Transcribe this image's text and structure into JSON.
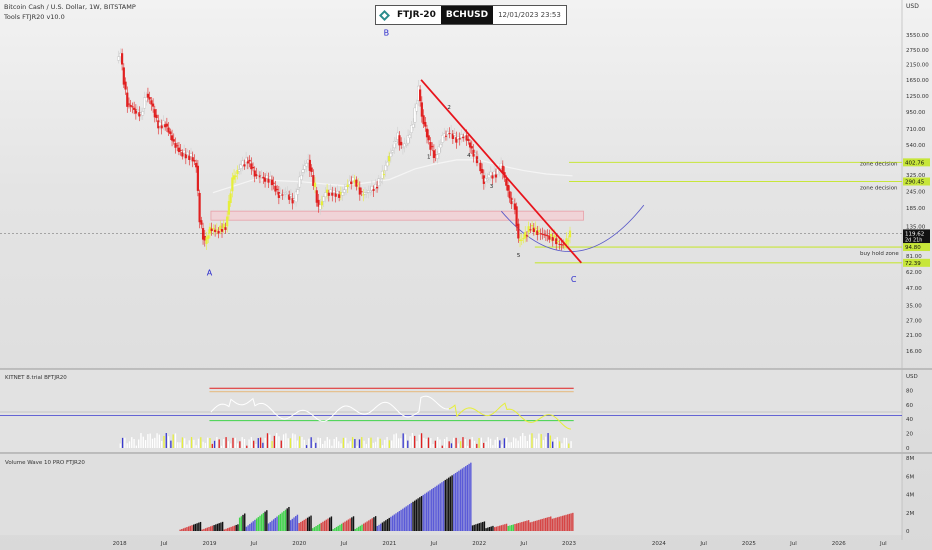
{
  "header": {
    "symbol_line": "Bitcoin Cash / U.S. Dollar, 1W, BITSTAMP",
    "tools_line": "Tools FTJR20 v10.0",
    "badge_left": "FTJR-20",
    "badge_symbol": "BCHUSD",
    "badge_date": "12/01/2023 23:53"
  },
  "panes": {
    "indicator_title": "KITNET  8.trial  BFTJR20",
    "volume_title": "Volume Wave 10 PRO FTJR20"
  },
  "colors": {
    "candle_up": "#ffffff",
    "candle_down": "#e02020",
    "candle_yellow": "#e6ef3a",
    "trendline": "#e8141c",
    "zone_line": "#c7e63a",
    "cup_curve": "#5a5ac8",
    "moving_average": "#f5f5f5",
    "volume_blue": "#5a5ad8",
    "volume_red": "#d64545",
    "volume_green": "#3fd34a",
    "volume_black": "#111111"
  },
  "chart_data": {
    "type": "candlestick",
    "x_ticks": [
      "2018",
      "Jul",
      "2019",
      "Jul",
      "2020",
      "Jul",
      "2021",
      "Jul",
      "2022",
      "Jul",
      "2023",
      "2024",
      "Jul",
      "2025",
      "Jul",
      "2026",
      "Jul"
    ],
    "y_axis_unit": "USD",
    "y_ticks": [
      "3550.00",
      "2750.00",
      "2150.00",
      "1650.00",
      "1250.00",
      "950.00",
      "710.00",
      "540.00",
      "410.00",
      "325.00",
      "245.00",
      "185.00",
      "135.00",
      "81.00",
      "62.00",
      "47.00",
      "35.00",
      "27.00",
      "21.00",
      "16.00"
    ],
    "price_labels": [
      {
        "value": "402.76",
        "color": "#c7e63a"
      },
      {
        "value": "290.45",
        "color": "#c7e63a"
      },
      {
        "value": "119.62",
        "sub": "2d 21h",
        "color": "#111111"
      },
      {
        "value": "94.80",
        "color": "#c7e63a"
      },
      {
        "value": "72.39",
        "color": "#c7e63a"
      }
    ],
    "zone_labels": [
      "zone decision",
      "zone decision",
      "buy hold zone"
    ],
    "wave_labels": [
      "A",
      "B",
      "C"
    ],
    "sub_wave_labels": [
      "1",
      "2",
      "3",
      "4",
      "5"
    ],
    "price_points": [
      [
        "2017-12-25",
        2300
      ],
      [
        "2018-01-08",
        2600
      ],
      [
        "2018-01-22",
        1600
      ],
      [
        "2018-02-05",
        1100
      ],
      [
        "2018-03-05",
        1000
      ],
      [
        "2018-04-02",
        900
      ],
      [
        "2018-04-23",
        1300
      ],
      [
        "2018-05-14",
        1100
      ],
      [
        "2018-06-11",
        750
      ],
      [
        "2018-07-09",
        780
      ],
      [
        "2018-08-13",
        560
      ],
      [
        "2018-09-10",
        480
      ],
      [
        "2018-10-22",
        440
      ],
      [
        "2018-11-12",
        380
      ],
      [
        "2018-11-26",
        150
      ],
      [
        "2018-12-17",
        100
      ],
      [
        "2019-01-07",
        130
      ],
      [
        "2019-02-04",
        125
      ],
      [
        "2019-03-11",
        135
      ],
      [
        "2019-04-08",
        300
      ],
      [
        "2019-05-13",
        380
      ],
      [
        "2019-06-10",
        420
      ],
      [
        "2019-07-08",
        330
      ],
      [
        "2019-08-12",
        310
      ],
      [
        "2019-09-09",
        300
      ],
      [
        "2019-10-14",
        230
      ],
      [
        "2019-11-11",
        240
      ],
      [
        "2019-12-16",
        205
      ],
      [
        "2020-01-13",
        340
      ],
      [
        "2020-02-10",
        420
      ],
      [
        "2020-03-09",
        250
      ],
      [
        "2020-03-23",
        180
      ],
      [
        "2020-04-20",
        240
      ],
      [
        "2020-05-18",
        240
      ],
      [
        "2020-06-22",
        230
      ],
      [
        "2020-07-27",
        290
      ],
      [
        "2020-08-17",
        300
      ],
      [
        "2020-09-14",
        230
      ],
      [
        "2020-10-19",
        250
      ],
      [
        "2020-11-16",
        270
      ],
      [
        "2020-12-14",
        350
      ],
      [
        "2021-01-11",
        480
      ],
      [
        "2021-02-08",
        640
      ],
      [
        "2021-02-22",
        510
      ],
      [
        "2021-03-15",
        560
      ],
      [
        "2021-04-12",
        800
      ],
      [
        "2021-05-03",
        1400
      ],
      [
        "2021-05-17",
        900
      ],
      [
        "2021-06-14",
        570
      ],
      [
        "2021-07-12",
        430
      ],
      [
        "2021-08-09",
        620
      ],
      [
        "2021-09-06",
        680
      ],
      [
        "2021-10-04",
        600
      ],
      [
        "2021-11-08",
        640
      ],
      [
        "2021-12-06",
        500
      ],
      [
        "2022-01-03",
        400
      ],
      [
        "2022-01-24",
        290
      ],
      [
        "2022-02-14",
        320
      ],
      [
        "2022-03-14",
        330
      ],
      [
        "2022-04-04",
        380
      ],
      [
        "2022-05-09",
        220
      ],
      [
        "2022-05-30",
        190
      ],
      [
        "2022-06-13",
        105
      ],
      [
        "2022-07-04",
        110
      ],
      [
        "2022-08-01",
        135
      ],
      [
        "2022-09-05",
        120
      ],
      [
        "2022-10-10",
        115
      ],
      [
        "2022-11-07",
        110
      ],
      [
        "2022-11-21",
        100
      ],
      [
        "2022-12-19",
        98
      ],
      [
        "2023-01-09",
        119.62
      ]
    ],
    "trendline": {
      "from": [
        "2021-05-10",
        1650
      ],
      "to": [
        "2023-02-20",
        72.39
      ]
    },
    "horizontal_levels": [
      402.76,
      290.45,
      94.8,
      72.39
    ],
    "consolidation_box": {
      "from": "2019-01-07",
      "to": "2023-03-01",
      "low": 150,
      "high": 175
    },
    "indicator_axis": {
      "ticks": [
        "USD",
        "80",
        "60",
        "40",
        "20",
        "0"
      ]
    },
    "volume_axis": {
      "ticks": [
        "8M",
        "6M",
        "4M",
        "2M",
        "0"
      ]
    }
  }
}
